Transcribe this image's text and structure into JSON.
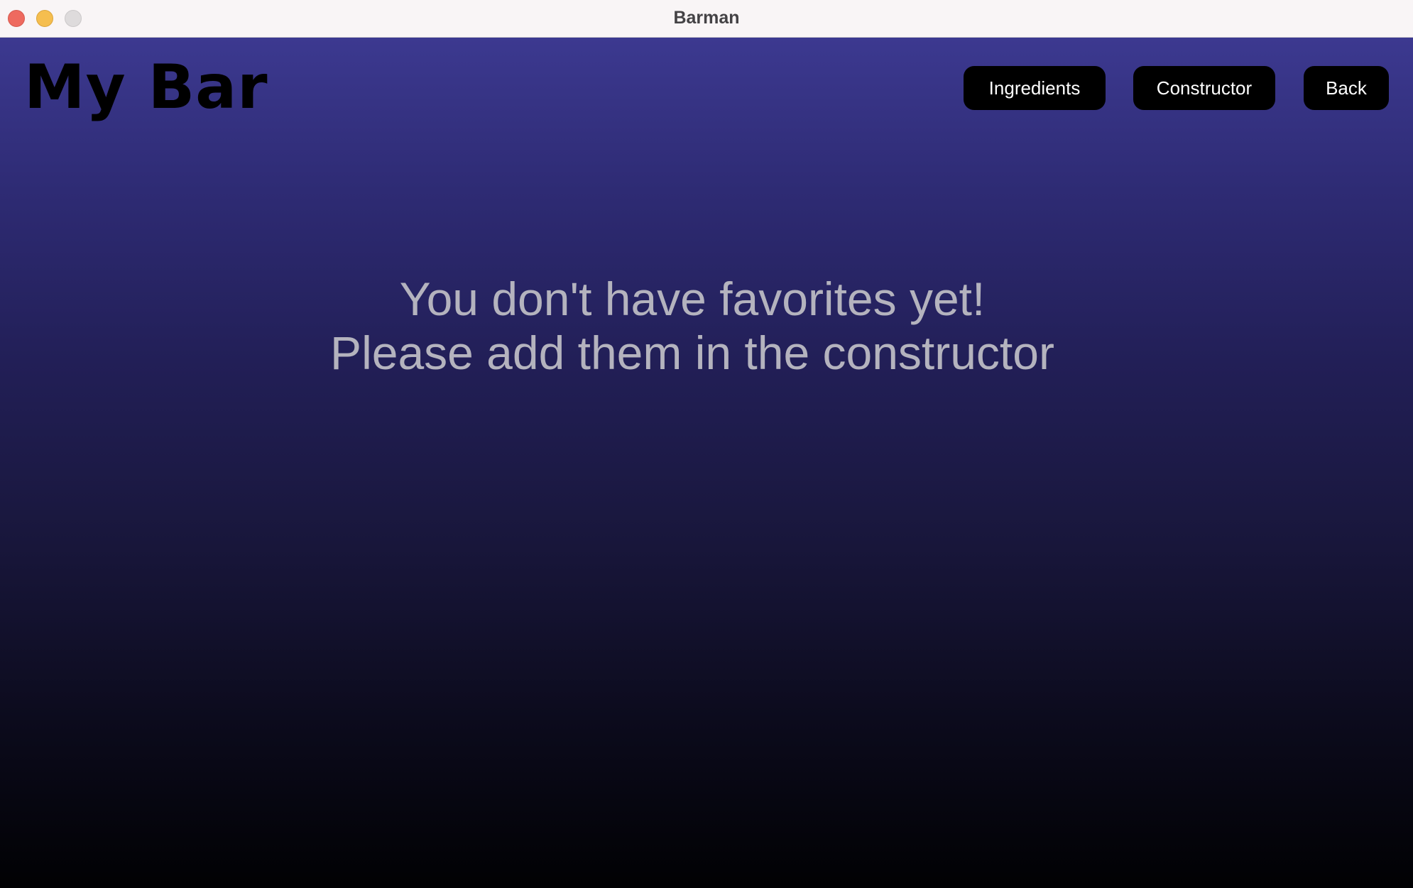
{
  "window": {
    "title": "Barman"
  },
  "header": {
    "app_title": "My Bar",
    "buttons": {
      "ingredients": "Ingredients",
      "constructor": "Constructor",
      "back": "Back"
    }
  },
  "main": {
    "empty_message_line1": "You don't have favorites yet!",
    "empty_message_line2": "Please add them in the constructor"
  },
  "colors": {
    "gradient_top": "#3c3990",
    "gradient_bottom": "#010103",
    "button_bg": "#000000",
    "button_text": "#ffffff",
    "message_text": "#b4b3be"
  }
}
